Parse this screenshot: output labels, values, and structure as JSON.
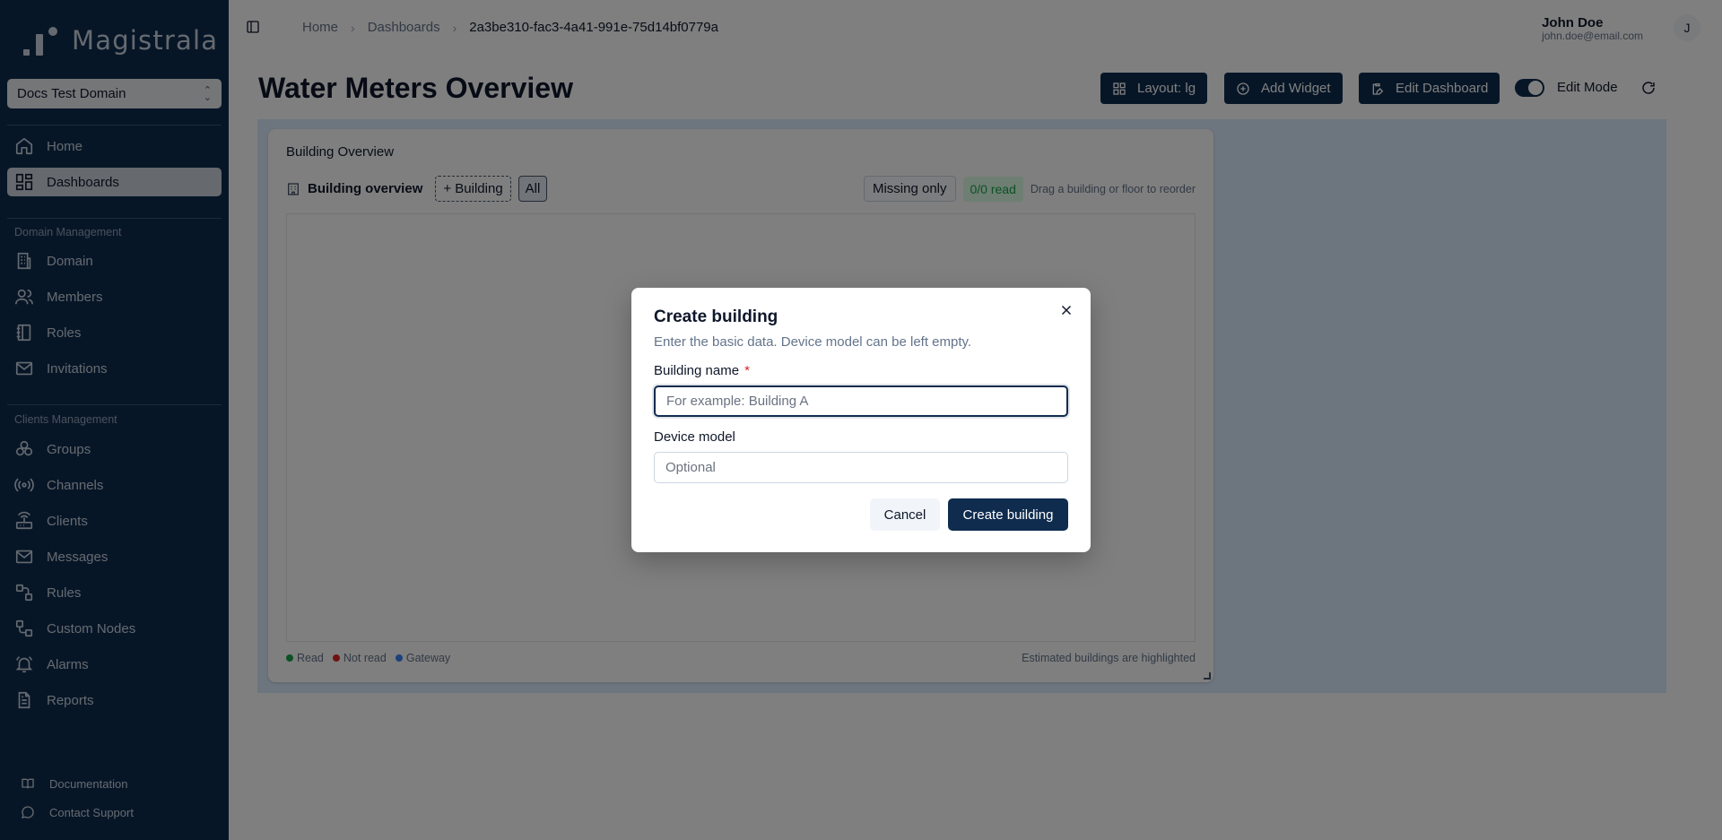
{
  "app": {
    "brand": "Magistrala"
  },
  "sidebar": {
    "domain_select": "Docs Test Domain",
    "primary": [
      {
        "label": "Home",
        "icon": "home-icon"
      },
      {
        "label": "Dashboards",
        "icon": "dashboard-icon",
        "active": true
      }
    ],
    "domain_section_label": "Domain Management",
    "domain_items": [
      {
        "label": "Domain",
        "icon": "building-icon"
      },
      {
        "label": "Members",
        "icon": "users-icon"
      },
      {
        "label": "Roles",
        "icon": "notebook-icon"
      },
      {
        "label": "Invitations",
        "icon": "mail-icon"
      }
    ],
    "clients_section_label": "Clients Management",
    "clients_items": [
      {
        "label": "Groups",
        "icon": "groups-icon"
      },
      {
        "label": "Channels",
        "icon": "radio-icon"
      },
      {
        "label": "Clients",
        "icon": "router-icon"
      },
      {
        "label": "Messages",
        "icon": "messages-icon"
      },
      {
        "label": "Rules",
        "icon": "rules-icon"
      },
      {
        "label": "Custom Nodes",
        "icon": "nodes-icon"
      },
      {
        "label": "Alarms",
        "icon": "bell-icon"
      },
      {
        "label": "Reports",
        "icon": "report-icon"
      }
    ],
    "footer": [
      {
        "label": "Documentation",
        "icon": "book-icon"
      },
      {
        "label": "Contact Support",
        "icon": "chat-icon"
      }
    ]
  },
  "header": {
    "breadcrumbs": [
      "Home",
      "Dashboards",
      "2a3be310-fac3-4a41-991e-75d14bf0779a"
    ],
    "user_name": "John Doe",
    "user_email": "john.doe@email.com",
    "avatar_initial": "J"
  },
  "page": {
    "title": "Water Meters Overview",
    "layout_label": "Layout: lg",
    "add_widget_label": "Add Widget",
    "edit_dashboard_label": "Edit Dashboard",
    "edit_mode_label": "Edit Mode",
    "edit_mode_on": true
  },
  "widget": {
    "title": "Building Overview",
    "header_label": "Building overview",
    "add_building_chip": "+ Building",
    "all_chip": "All",
    "missing_only": "Missing only",
    "read_count": "0/0 read",
    "hint": "Drag a building or floor to reorder",
    "legend": [
      {
        "label": "Read",
        "color": "#16a34a"
      },
      {
        "label": "Not read",
        "color": "#dc2626"
      },
      {
        "label": "Gateway",
        "color": "#3b82f6"
      }
    ],
    "estimated_note": "Estimated buildings are highlighted"
  },
  "dialog": {
    "title": "Create building",
    "description": "Enter the basic data. Device model can be left empty.",
    "building_name_label": "Building name",
    "required_mark": "*",
    "building_name_value": "",
    "building_name_placeholder": "For example: Building A",
    "device_model_label": "Device model",
    "device_model_value": "",
    "device_model_placeholder": "Optional",
    "cancel_label": "Cancel",
    "submit_label": "Create building"
  }
}
